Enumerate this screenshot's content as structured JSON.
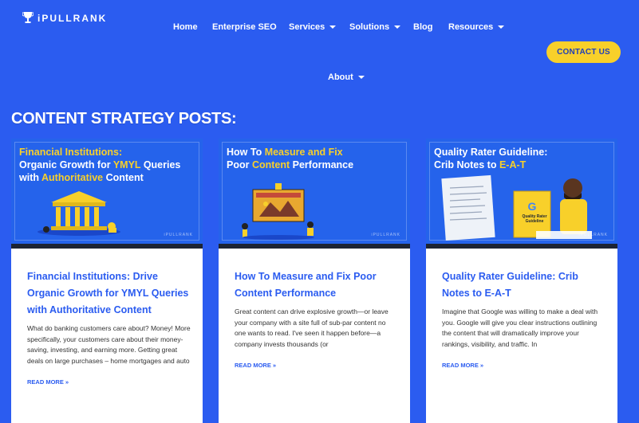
{
  "brand": {
    "logo_text": "iPULLRANK"
  },
  "nav": {
    "items": [
      {
        "label": "Home"
      },
      {
        "label": "Enterprise SEO"
      },
      {
        "label": "Services"
      },
      {
        "label": "Solutions"
      },
      {
        "label": "Blog"
      },
      {
        "label": "Resources"
      }
    ],
    "about_label": "About",
    "contact_label": "CONTACT US"
  },
  "section": {
    "title": "CONTENT STRATEGY POSTS:"
  },
  "cards": [
    {
      "image": {
        "line1": "Financial Institutions:",
        "line2a": "Organic Growth for ",
        "line2b": "YMYL",
        "line2c": " Queries",
        "line3a": "with ",
        "line3b": "Authoritative",
        "line3c": " Content",
        "mark": "iPULLRANK"
      },
      "title": "Financial Institutions: Drive Organic Growth for YMYL Queries with Authoritative Content",
      "excerpt": "What do banking customers care about? Money! More specifically, your customers care about their money-saving, investing, and earning more. Getting great deals on large purchases – home mortgages and auto",
      "read_more": "READ MORE »"
    },
    {
      "image": {
        "line1a": "How To ",
        "line1b": "Measure and Fix",
        "line2a": "Poor ",
        "line2b": "Content",
        "line2c": " Performance",
        "mark": "iPULLRANK"
      },
      "title": "How To Measure and Fix Poor Content Performance",
      "excerpt": "Great content can drive explosive growth—or leave your company with a site full of sub-par content no one wants to read.  I've seen it happen before—a company invests thousands (or",
      "read_more": "READ MORE »"
    },
    {
      "image": {
        "line1": "Quality Rater Guideline:",
        "line2a": "Crib Notes to ",
        "line2b": "E-A-T",
        "book_text": "Quality Rater Guideline",
        "mark": "iPULLRANK"
      },
      "title": "Quality Rater Guideline: Crib Notes to E-A-T",
      "excerpt": "Imagine that Google was willing to make a deal with you.  Google will give you clear instructions outlining the content that will dramatically improve your rankings, visibility, and traffic. In",
      "read_more": "READ MORE »"
    }
  ],
  "colors": {
    "brand_blue": "#2b5cf0",
    "accent_yellow": "#f8d02a"
  }
}
